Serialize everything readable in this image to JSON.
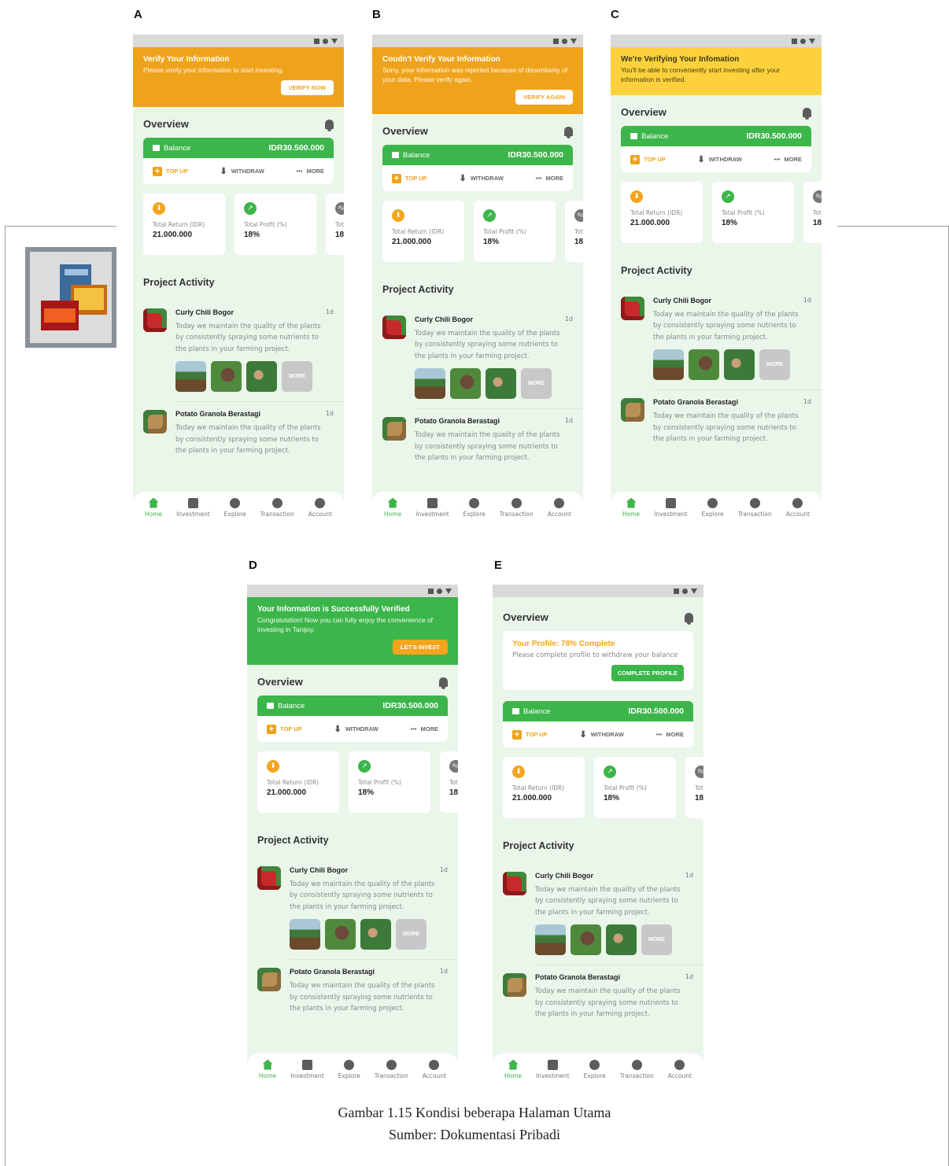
{
  "panels": {
    "A": {
      "letter": "A",
      "banner_title": "Verify Your Information",
      "banner_text": "Please verify your information to start investing.",
      "banner_button": "VERIFY NOW"
    },
    "B": {
      "letter": "B",
      "banner_title": "Coudn't Verify Your Information",
      "banner_text": "Sorry, your information was rejected because of dissimilarity of your data. Please verify again.",
      "banner_button": "VERIFY AGAIN"
    },
    "C": {
      "letter": "C",
      "banner_title": "We're Verifying Your Infomation",
      "banner_text": "You'll be able to conveniently start investing after your information is verified."
    },
    "D": {
      "letter": "D",
      "banner_title": "Your Information is Successfully Verified",
      "banner_text": "Congratulation! Now you can fully enjoy the convenience of investing in Tanijoy.",
      "banner_button": "LET'S INVEST"
    },
    "E": {
      "letter": "E",
      "profile_title": "Your Profile: 78% Complete",
      "profile_text": "Please complete profile to withdraw your balance",
      "profile_button": "COMPLETE PROFILE"
    }
  },
  "overview": {
    "title": "Overview",
    "balance_label": "Balance",
    "balance_amount": "IDR30.500.000",
    "topup": "TOP UP",
    "withdraw": "WITHDRAW",
    "more": "MORE"
  },
  "stats": {
    "return_label": "Total Return (IDR)",
    "return_value": "21.000.000",
    "profit_label": "Total Profit (%)",
    "profit_value": "18%",
    "partial_icon": "Rp",
    "partial_label": "Tot",
    "partial_value": "18"
  },
  "activity": {
    "title": "Project Activity",
    "item1_name": "Curly Chili Bogor",
    "item1_time": "1d",
    "item1_desc": "Today we maintain the quality of the plants by consistently spraying some nutrients to the plants in your farming project.",
    "item2_name": "Potato Granola Berastagi",
    "item2_time": "1d",
    "item2_desc": "Today we maintain the quality of the plants by consistently spraying some nutrients to the plants in your farming project.",
    "more_photos": "MORE"
  },
  "tabbar": {
    "home": "Home",
    "investment": "Investment",
    "explore": "Explore",
    "transaction": "Transaction",
    "account": "Account"
  },
  "caption": {
    "line1": "Gambar 1.15 Kondisi beberapa Halaman Utama",
    "line2": "Sumber: Dokumentasi Pribadi"
  },
  "colors": {
    "brand_green": "#3cb54a",
    "warning_orange": "#efa31c",
    "pending_yellow": "#fdd13b",
    "background": "#eaf6ea"
  }
}
